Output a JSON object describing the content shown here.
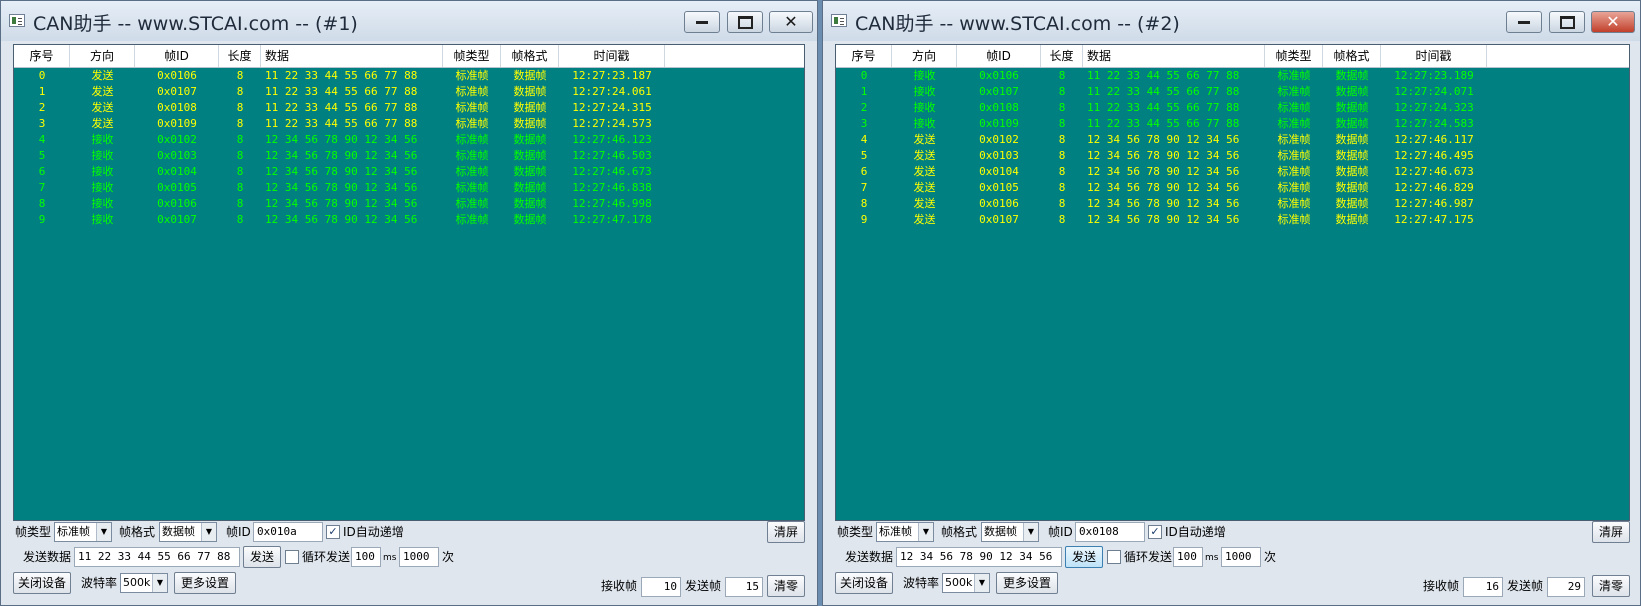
{
  "columns": [
    "序号",
    "方向",
    "帧ID",
    "长度",
    "数据",
    "帧类型",
    "帧格式",
    "时间戳"
  ],
  "colors": {
    "grid_bg": "#008080",
    "send": "#ffff00",
    "recv": "#00ff00"
  },
  "labels": {
    "frame_type": "帧类型",
    "frame_format": "帧格式",
    "frame_id": "帧ID",
    "id_auto_inc": "ID自动递增",
    "send_data": "发送数据",
    "send_btn": "发送",
    "loop_send": "循环发送",
    "ms": "ms",
    "times": "次",
    "close_device": "关闭设备",
    "baud_rate": "波特率",
    "more_settings": "更多设置",
    "clear_screen": "清屏",
    "recv_frames": "接收帧",
    "send_frames": "发送帧",
    "reset": "清零"
  },
  "windows": [
    {
      "title": "CAN助手 -- www.STCAI.com -- (#1)",
      "rows": [
        {
          "no": "0",
          "dir": "发送",
          "id": "0x0106",
          "len": "8",
          "data": "11 22 33 44 55 66 77 88",
          "type": "标准帧",
          "fmt": "数据帧",
          "ts": "12:27:23.187",
          "kind": "send"
        },
        {
          "no": "1",
          "dir": "发送",
          "id": "0x0107",
          "len": "8",
          "data": "11 22 33 44 55 66 77 88",
          "type": "标准帧",
          "fmt": "数据帧",
          "ts": "12:27:24.061",
          "kind": "send"
        },
        {
          "no": "2",
          "dir": "发送",
          "id": "0x0108",
          "len": "8",
          "data": "11 22 33 44 55 66 77 88",
          "type": "标准帧",
          "fmt": "数据帧",
          "ts": "12:27:24.315",
          "kind": "send"
        },
        {
          "no": "3",
          "dir": "发送",
          "id": "0x0109",
          "len": "8",
          "data": "11 22 33 44 55 66 77 88",
          "type": "标准帧",
          "fmt": "数据帧",
          "ts": "12:27:24.573",
          "kind": "send"
        },
        {
          "no": "4",
          "dir": "接收",
          "id": "0x0102",
          "len": "8",
          "data": "12 34 56 78 90 12 34 56",
          "type": "标准帧",
          "fmt": "数据帧",
          "ts": "12:27:46.123",
          "kind": "recv"
        },
        {
          "no": "5",
          "dir": "接收",
          "id": "0x0103",
          "len": "8",
          "data": "12 34 56 78 90 12 34 56",
          "type": "标准帧",
          "fmt": "数据帧",
          "ts": "12:27:46.503",
          "kind": "recv"
        },
        {
          "no": "6",
          "dir": "接收",
          "id": "0x0104",
          "len": "8",
          "data": "12 34 56 78 90 12 34 56",
          "type": "标准帧",
          "fmt": "数据帧",
          "ts": "12:27:46.673",
          "kind": "recv"
        },
        {
          "no": "7",
          "dir": "接收",
          "id": "0x0105",
          "len": "8",
          "data": "12 34 56 78 90 12 34 56",
          "type": "标准帧",
          "fmt": "数据帧",
          "ts": "12:27:46.838",
          "kind": "recv"
        },
        {
          "no": "8",
          "dir": "接收",
          "id": "0x0106",
          "len": "8",
          "data": "12 34 56 78 90 12 34 56",
          "type": "标准帧",
          "fmt": "数据帧",
          "ts": "12:27:46.998",
          "kind": "recv"
        },
        {
          "no": "9",
          "dir": "接收",
          "id": "0x0107",
          "len": "8",
          "data": "12 34 56 78 90 12 34 56",
          "type": "标准帧",
          "fmt": "数据帧",
          "ts": "12:27:47.178",
          "kind": "recv"
        }
      ],
      "frame_type_value": "标准帧",
      "frame_format_value": "数据帧",
      "frame_id_value": "0x010a",
      "id_auto_checked": true,
      "send_data_value": "11 22 33 44 55 66 77 88",
      "loop_checked": false,
      "interval_value": "100",
      "count_value": "1000",
      "baud_value": "500k",
      "recv_count": "10",
      "send_count": "15",
      "send_btn_active": false
    },
    {
      "title": "CAN助手 -- www.STCAI.com -- (#2)",
      "rows": [
        {
          "no": "0",
          "dir": "接收",
          "id": "0x0106",
          "len": "8",
          "data": "11 22 33 44 55 66 77 88",
          "type": "标准帧",
          "fmt": "数据帧",
          "ts": "12:27:23.189",
          "kind": "recv"
        },
        {
          "no": "1",
          "dir": "接收",
          "id": "0x0107",
          "len": "8",
          "data": "11 22 33 44 55 66 77 88",
          "type": "标准帧",
          "fmt": "数据帧",
          "ts": "12:27:24.071",
          "kind": "recv"
        },
        {
          "no": "2",
          "dir": "接收",
          "id": "0x0108",
          "len": "8",
          "data": "11 22 33 44 55 66 77 88",
          "type": "标准帧",
          "fmt": "数据帧",
          "ts": "12:27:24.323",
          "kind": "recv"
        },
        {
          "no": "3",
          "dir": "接收",
          "id": "0x0109",
          "len": "8",
          "data": "11 22 33 44 55 66 77 88",
          "type": "标准帧",
          "fmt": "数据帧",
          "ts": "12:27:24.583",
          "kind": "recv"
        },
        {
          "no": "4",
          "dir": "发送",
          "id": "0x0102",
          "len": "8",
          "data": "12 34 56 78 90 12 34 56",
          "type": "标准帧",
          "fmt": "数据帧",
          "ts": "12:27:46.117",
          "kind": "send"
        },
        {
          "no": "5",
          "dir": "发送",
          "id": "0x0103",
          "len": "8",
          "data": "12 34 56 78 90 12 34 56",
          "type": "标准帧",
          "fmt": "数据帧",
          "ts": "12:27:46.495",
          "kind": "send"
        },
        {
          "no": "6",
          "dir": "发送",
          "id": "0x0104",
          "len": "8",
          "data": "12 34 56 78 90 12 34 56",
          "type": "标准帧",
          "fmt": "数据帧",
          "ts": "12:27:46.673",
          "kind": "send"
        },
        {
          "no": "7",
          "dir": "发送",
          "id": "0x0105",
          "len": "8",
          "data": "12 34 56 78 90 12 34 56",
          "type": "标准帧",
          "fmt": "数据帧",
          "ts": "12:27:46.829",
          "kind": "send"
        },
        {
          "no": "8",
          "dir": "发送",
          "id": "0x0106",
          "len": "8",
          "data": "12 34 56 78 90 12 34 56",
          "type": "标准帧",
          "fmt": "数据帧",
          "ts": "12:27:46.987",
          "kind": "send"
        },
        {
          "no": "9",
          "dir": "发送",
          "id": "0x0107",
          "len": "8",
          "data": "12 34 56 78 90 12 34 56",
          "type": "标准帧",
          "fmt": "数据帧",
          "ts": "12:27:47.175",
          "kind": "send"
        }
      ],
      "frame_type_value": "标准帧",
      "frame_format_value": "数据帧",
      "frame_id_value": "0x0108",
      "id_auto_checked": true,
      "send_data_value": "12 34 56 78 90 12 34 56",
      "loop_checked": false,
      "interval_value": "100",
      "count_value": "1000",
      "baud_value": "500k",
      "recv_count": "16",
      "send_count": "29",
      "send_btn_active": true
    }
  ]
}
